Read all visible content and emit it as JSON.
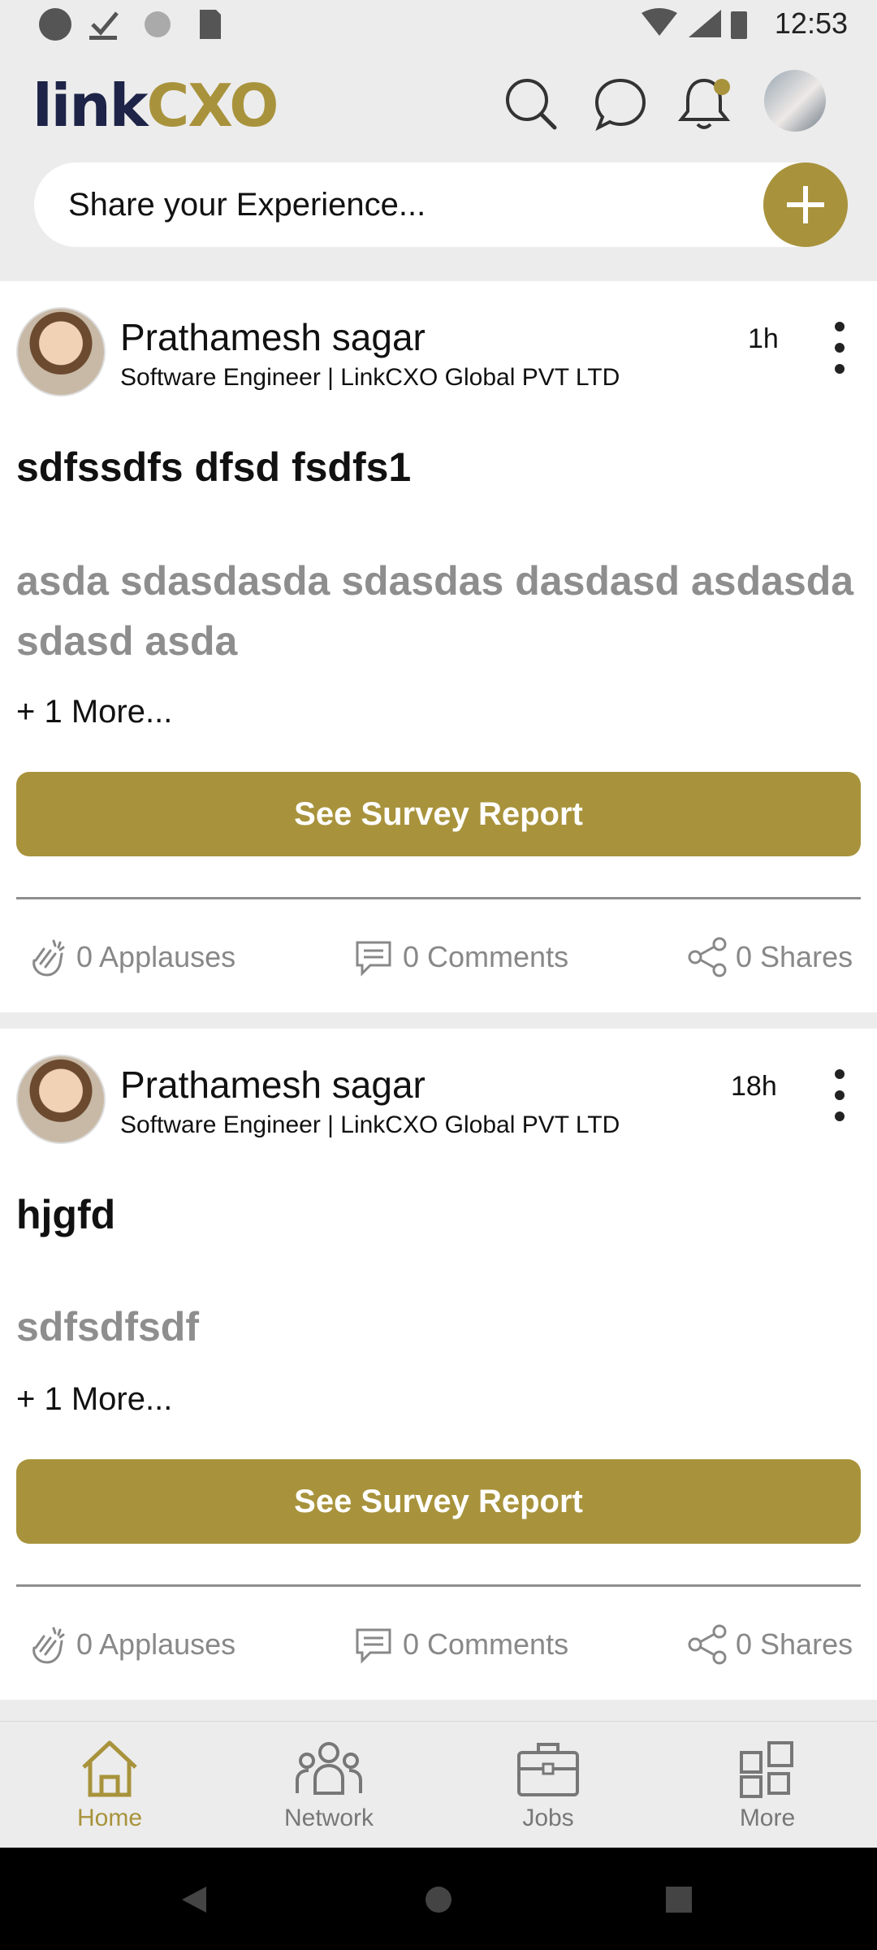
{
  "status_bar": {
    "time": "12:53"
  },
  "header": {
    "logo": {
      "part1": "link",
      "part2": "CXO"
    },
    "share_placeholder": "Share your Experience..."
  },
  "posts": [
    {
      "author": "Prathamesh sagar",
      "role": "Software  Engineer | LinkCXO Global PVT LTD",
      "time": "1h",
      "title": "sdfssdfs dfsd fsdfs1",
      "body": "asda sdasdasda sdasdas dasdasd asdasda sdasd asda",
      "more": "+ 1 More...",
      "button": "See Survey Report",
      "applauses": "0 Applauses",
      "comments": "0 Comments",
      "shares": "0 Shares"
    },
    {
      "author": "Prathamesh sagar",
      "role": "Software  Engineer | LinkCXO Global PVT LTD",
      "time": "18h",
      "title": "hjgfd",
      "body": "sdfsdfsdf",
      "more": "+ 1 More...",
      "button": "See Survey Report",
      "applauses": "0 Applauses",
      "comments": "0 Comments",
      "shares": "0 Shares"
    }
  ],
  "bottom_nav": [
    {
      "label": "Home",
      "icon": "home-icon",
      "active": true
    },
    {
      "label": "Network",
      "icon": "network-icon",
      "active": false
    },
    {
      "label": "Jobs",
      "icon": "briefcase-icon",
      "active": false
    },
    {
      "label": "More",
      "icon": "grid-icon",
      "active": false
    }
  ],
  "colors": {
    "brand_gold": "#a8933c",
    "brand_navy": "#1e2447"
  }
}
